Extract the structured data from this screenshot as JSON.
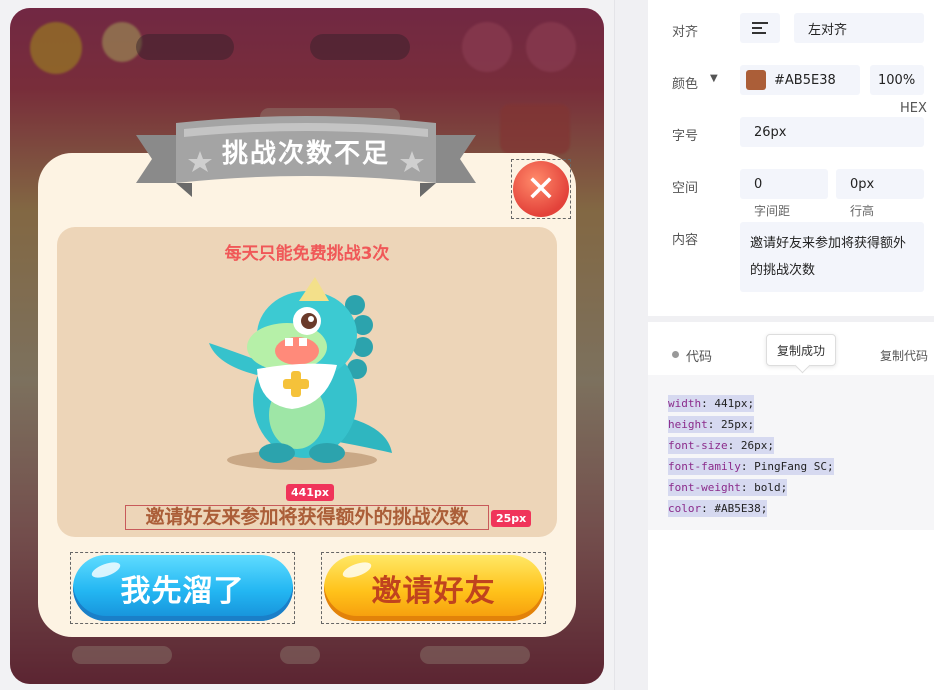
{
  "dialog": {
    "title": "挑战次数不足",
    "subtitle": "每天只能免费挑战3次",
    "invite_text": "邀请好友来参加将获得额外的挑战次数",
    "width_tag": "441px",
    "height_tag": "25px",
    "button_later": "我先溜了",
    "button_invite": "邀请好友",
    "close_glyph": "✕"
  },
  "panel": {
    "align": {
      "label": "对齐",
      "icon": "align-left-icon",
      "value": "左对齐"
    },
    "color": {
      "label": "颜色",
      "swatch": "#AB5E38",
      "hex": "#AB5E38",
      "opacity": "100%",
      "format": "HEX"
    },
    "font_size": {
      "label": "字号",
      "value": "26px"
    },
    "spacing": {
      "label": "空间",
      "letter_spacing": "0",
      "letter_spacing_hint": "字间距",
      "line_height": "0px",
      "line_height_hint": "行高"
    },
    "content": {
      "label": "内容",
      "value": "邀请好友来参加将获得额外的挑战次数"
    },
    "code": {
      "label": "代码",
      "copy_label": "复制代码",
      "toast": "复制成功",
      "lines": [
        {
          "k": "width",
          "v": "441px;"
        },
        {
          "k": "height",
          "v": "25px;"
        },
        {
          "k": "font-size",
          "v": "26px;"
        },
        {
          "k": "font-family",
          "v": "PingFang SC;"
        },
        {
          "k": "font-weight",
          "v": "bold;"
        },
        {
          "k": "color",
          "v": "#AB5E38;"
        }
      ]
    }
  }
}
